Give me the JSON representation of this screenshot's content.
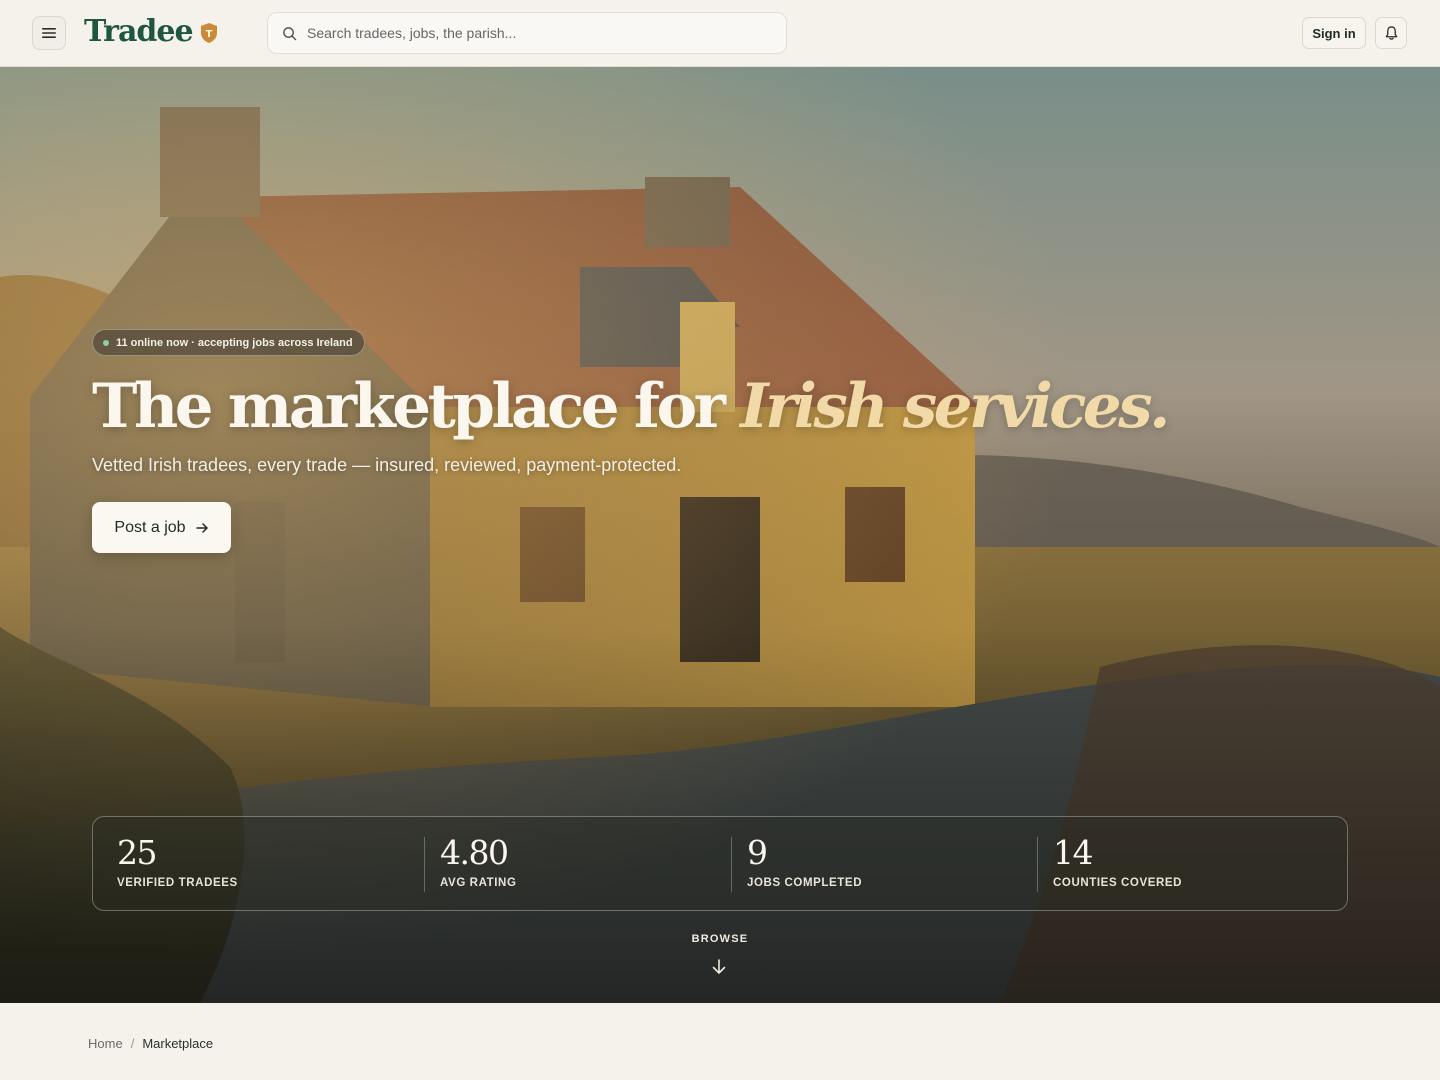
{
  "header": {
    "logo_text": "Tradee",
    "logo_badge": "T",
    "search_placeholder": "Search tradees, jobs, the parish...",
    "signin_label": "Sign in",
    "icons": [
      "menu-icon",
      "search-icon",
      "bell-icon",
      "shield-icon"
    ]
  },
  "hero": {
    "status_pill": "11 online now · accepting jobs across Ireland",
    "headline_main": "The marketplace for ",
    "headline_accent": "Irish services.",
    "subline": "Vetted Irish tradees, every trade — insured, reviewed, payment-protected.",
    "cta_label": "Post a job",
    "stats": [
      {
        "value": "25",
        "label": "VERIFIED TRADEES"
      },
      {
        "value": "4.80",
        "label": "AVG RATING"
      },
      {
        "value": "9",
        "label": "JOBS COMPLETED"
      },
      {
        "value": "14",
        "label": "COUNTIES COVERED"
      }
    ],
    "browse_label": "BROWSE"
  },
  "breadcrumb": {
    "home": "Home",
    "separator": "/",
    "current": "Marketplace"
  },
  "colors": {
    "brand_green": "#1f5641",
    "badge_orange": "#c98a3a",
    "page_bg": "#f5f2ec",
    "accent_cream": "#f1d9a8",
    "online_dot": "#8fd0a6"
  }
}
